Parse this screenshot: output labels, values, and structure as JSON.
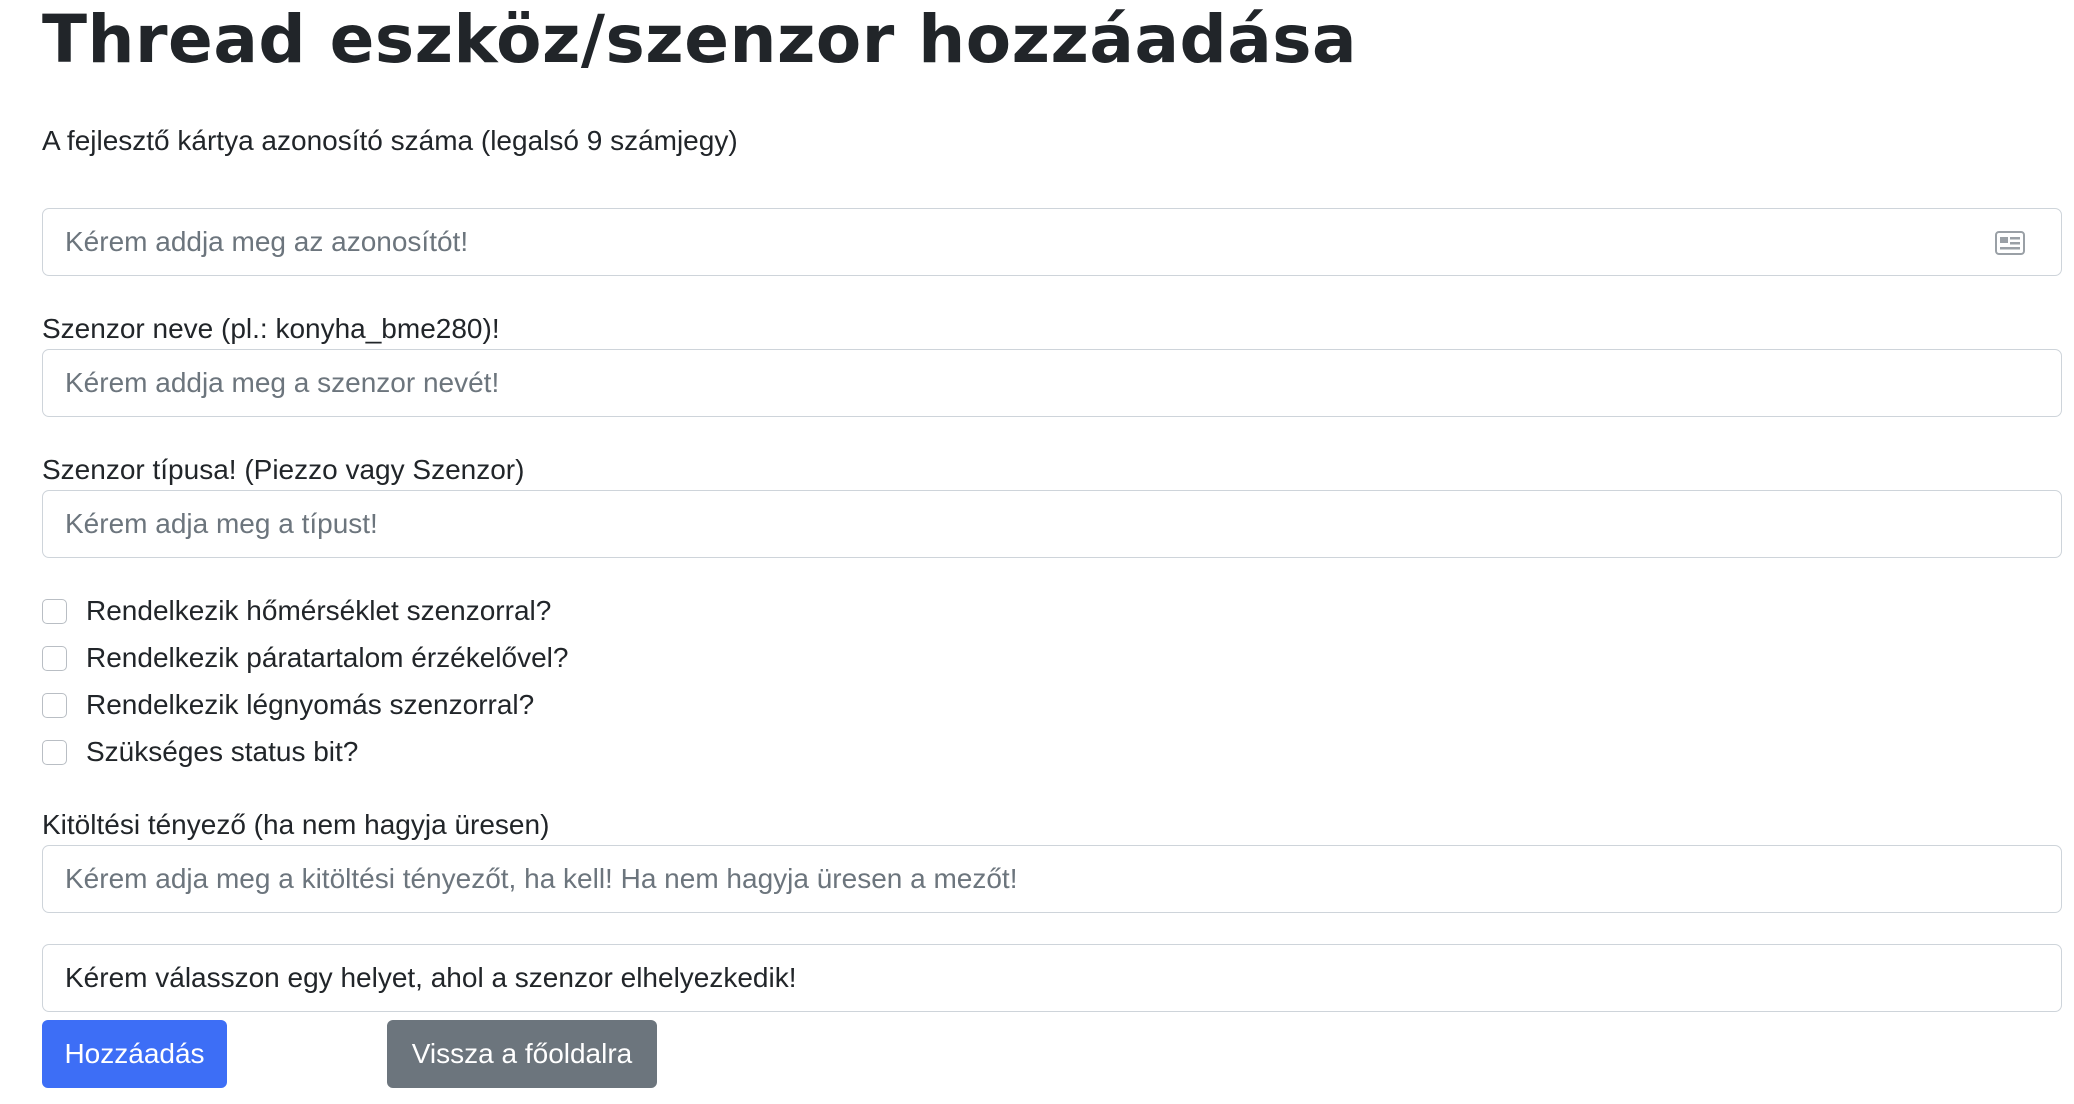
{
  "page": {
    "title": "Thread eszköz/szenzor hozzáadása"
  },
  "form": {
    "board_id": {
      "label": "A fejlesztő kártya azonosító száma (legalsó 9 számjegy)",
      "placeholder": "Kérem addja meg az azonosítót!",
      "value": "",
      "icon": "id-card-icon"
    },
    "sensor_name": {
      "label": "Szenzor neve (pl.: konyha_bme280)!",
      "placeholder": "Kérem addja meg a szenzor nevét!",
      "value": ""
    },
    "sensor_type": {
      "label": "Szenzor típusa! (Piezzo vagy Szenzor)",
      "placeholder": "Kérem adja meg a típust!",
      "value": ""
    },
    "checkboxes": [
      {
        "label": "Rendelkezik hőmérséklet szenzorral?",
        "checked": false
      },
      {
        "label": "Rendelkezik páratartalom érzékelővel?",
        "checked": false
      },
      {
        "label": "Rendelkezik légnyomás szenzorral?",
        "checked": false
      },
      {
        "label": "Szükséges status bit?",
        "checked": false
      }
    ],
    "fill_factor": {
      "label": "Kitöltési tényező (ha nem hagyja üresen)",
      "placeholder": "Kérem adja meg a kitöltési tényezőt, ha kell! Ha nem hagyja üresen a mezőt!",
      "value": ""
    },
    "location_select": {
      "selected": "Kérem válasszon egy helyet, ahol a szenzor elhelyezkedik!"
    },
    "buttons": {
      "add_label": "Hozzáadás",
      "back_label": "Vissza a főoldalra"
    }
  },
  "colors": {
    "primary": "#3d6ef6",
    "secondary": "#6c757d",
    "text": "#212529",
    "placeholder": "#6c757d",
    "border": "#ced4da"
  }
}
